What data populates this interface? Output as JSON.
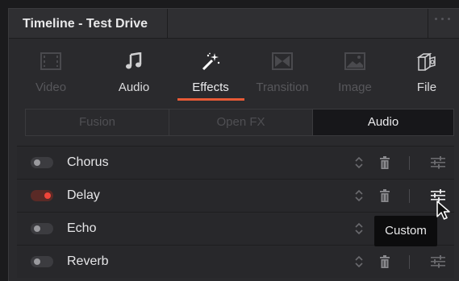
{
  "window": {
    "title": "Timeline - Test Drive"
  },
  "tabs": [
    {
      "label": "Video",
      "icon": "film-frame-icon",
      "enabled": false
    },
    {
      "label": "Audio",
      "icon": "music-note-icon",
      "enabled": true
    },
    {
      "label": "Effects",
      "icon": "magic-wand-icon",
      "enabled": true,
      "selected": true
    },
    {
      "label": "Transition",
      "icon": "transition-icon",
      "enabled": false
    },
    {
      "label": "Image",
      "icon": "image-icon",
      "enabled": false
    },
    {
      "label": "File",
      "icon": "file-cabinet-icon",
      "enabled": true
    }
  ],
  "effect_categories": {
    "items": [
      "Fusion",
      "Open FX",
      "Audio"
    ],
    "selected": "Audio"
  },
  "effects": [
    {
      "name": "Chorus",
      "enabled": false
    },
    {
      "name": "Delay",
      "enabled": true
    },
    {
      "name": "Echo",
      "enabled": false
    },
    {
      "name": "Reverb",
      "enabled": false
    }
  ],
  "tooltip": {
    "text": "Custom"
  },
  "colors": {
    "accent": "#e85a36",
    "toggle_on": "#f0453a",
    "panel_bg": "#2a2a2d"
  }
}
